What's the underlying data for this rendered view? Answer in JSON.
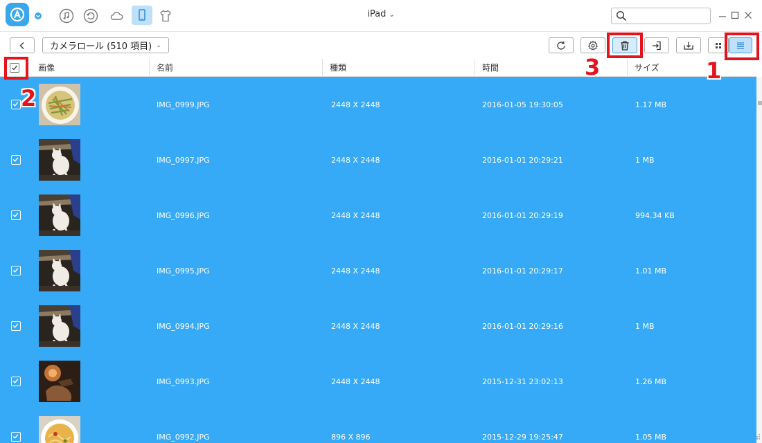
{
  "titlebar": {
    "device_name": "iPad",
    "device_chevron": "⌄",
    "icons": [
      "app-logo",
      "music-icon",
      "history-icon",
      "cloud-icon",
      "ipad-device-icon",
      "tshirt-icon"
    ],
    "search_placeholder": ""
  },
  "toolbar": {
    "album_label": "カメラロール (510 項目)",
    "album_chevron": "⌄",
    "buttons": [
      "back-icon",
      "refresh-icon",
      "settings-icon",
      "delete-icon",
      "import-icon",
      "export-icon",
      "grid-view-icon",
      "list-view-icon"
    ]
  },
  "table": {
    "headers": {
      "image": "画像",
      "name": "名前",
      "type": "種類",
      "time": "時間",
      "size": "サイズ"
    },
    "rows": [
      {
        "name": "IMG_0999.JPG",
        "dimensions": "2448 X 2448",
        "time": "2016-01-05 19:30:05",
        "size": "1.17 MB",
        "thumb": "food"
      },
      {
        "name": "IMG_0997.JPG",
        "dimensions": "2448 X 2448",
        "time": "2016-01-01 20:29:21",
        "size": "1 MB",
        "thumb": "cat"
      },
      {
        "name": "IMG_0996.JPG",
        "dimensions": "2448 X 2448",
        "time": "2016-01-01 20:29:19",
        "size": "994.34 KB",
        "thumb": "cat"
      },
      {
        "name": "IMG_0995.JPG",
        "dimensions": "2448 X 2448",
        "time": "2016-01-01 20:29:17",
        "size": "1.01 MB",
        "thumb": "cat"
      },
      {
        "name": "IMG_0994.JPG",
        "dimensions": "2448 X 2448",
        "time": "2016-01-01 20:29:16",
        "size": "1 MB",
        "thumb": "cat"
      },
      {
        "name": "IMG_0993.JPG",
        "dimensions": "2448 X 2448",
        "time": "2015-12-31 23:02:13",
        "size": "1.26 MB",
        "thumb": "dark"
      },
      {
        "name": "IMG_0992.JPG",
        "dimensions": "896 X 896",
        "time": "2015-12-29 19:25:47",
        "size": "1.05 MB",
        "thumb": "soup"
      }
    ]
  },
  "annotations": {
    "step1": "1",
    "step2": "2",
    "step3": "3"
  },
  "colors": {
    "selection": "#37aaf7",
    "accent": "#3aa7ec",
    "annotation": "#e4141e"
  }
}
